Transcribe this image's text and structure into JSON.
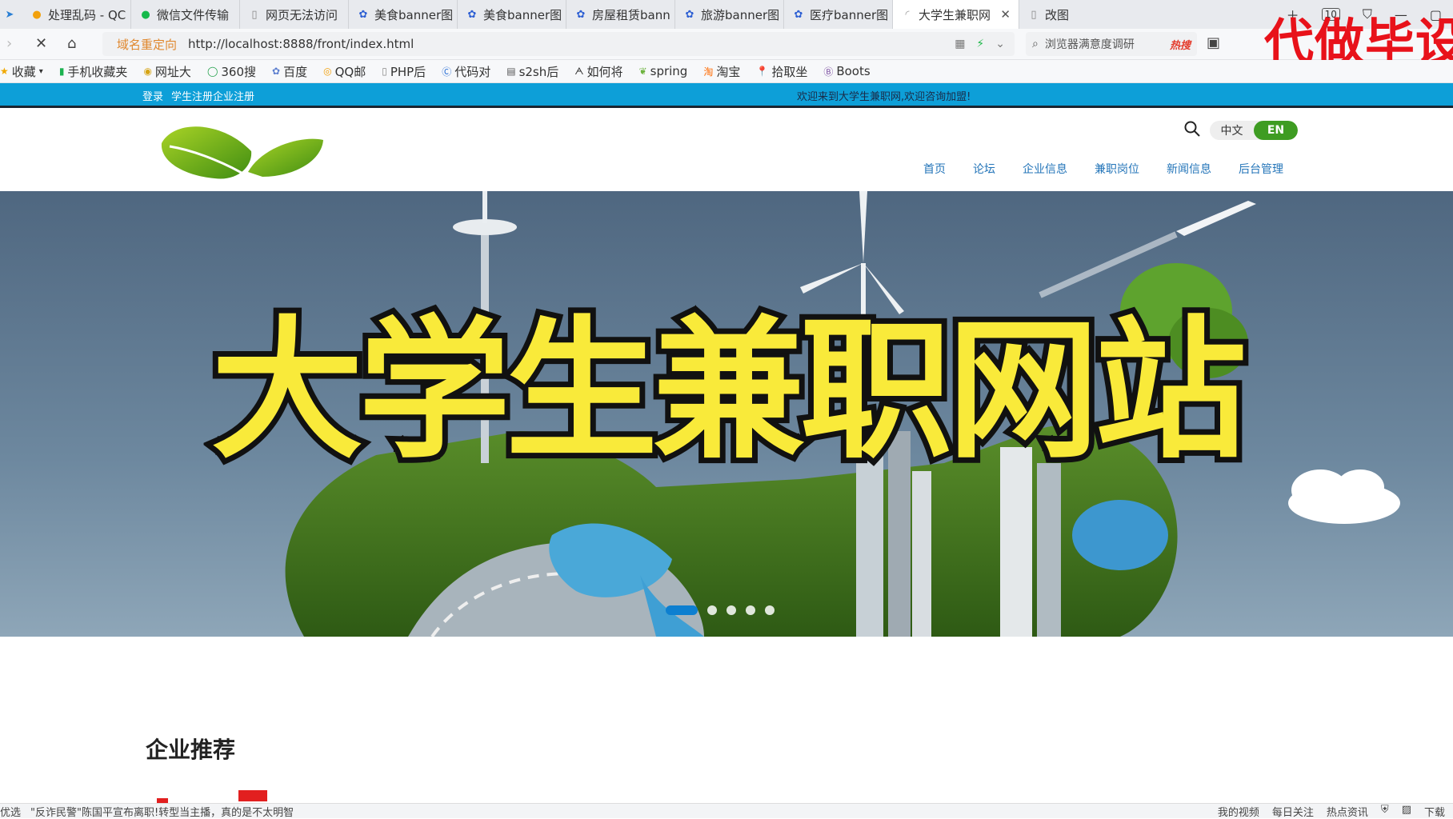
{
  "browser": {
    "tabs": [
      {
        "label": "处理乱码 - QC",
        "icon": "qq-browser-icon"
      },
      {
        "label": "微信文件传输",
        "icon": "wechat-icon"
      },
      {
        "label": "网页无法访问",
        "icon": "page-icon"
      },
      {
        "label": "美食banner图",
        "icon": "baidu-paw-icon"
      },
      {
        "label": "美食banner图",
        "icon": "baidu-paw-icon"
      },
      {
        "label": "房屋租赁bann",
        "icon": "baidu-paw-icon"
      },
      {
        "label": "旅游banner图",
        "icon": "baidu-paw-icon"
      },
      {
        "label": "医疗banner图",
        "icon": "baidu-paw-icon"
      },
      {
        "label": "大学生兼职网",
        "icon": "loading-icon",
        "active": true
      },
      {
        "label": "改图",
        "icon": "page-icon"
      }
    ],
    "tab_count": "10",
    "address": {
      "redirect_label": "域名重定向",
      "url": "http://localhost:8888/front/index.html"
    },
    "search": {
      "placeholder": "浏览器满意度调研",
      "hot_label": "热搜"
    },
    "overlay_text": "代做毕设",
    "bookmarks": [
      "收藏",
      "手机收藏夹",
      "网址大",
      "360搜",
      "百度",
      "QQ邮",
      "PHP后",
      "代码对",
      "s2sh后",
      "如何将",
      "spring",
      "淘宝",
      "拾取坐",
      "Boots"
    ]
  },
  "site": {
    "topbar": {
      "login": "登录",
      "student_register": "学生注册",
      "company_register": "企业注册",
      "welcome": "欢迎来到大学生兼职网,欢迎咨询加盟!"
    },
    "lang": {
      "zh": "中文",
      "en": "EN",
      "active": "EN"
    },
    "menu": [
      "首页",
      "论坛",
      "企业信息",
      "兼职岗位",
      "新闻信息",
      "后台管理"
    ],
    "hero": {
      "title": "大学生兼职网站",
      "slides": 5,
      "active_slide": 1
    },
    "section_title": "企业推荐"
  },
  "statusbar": {
    "left": [
      "优选",
      "\"反诈民警\"陈国平宣布离职!转型当主播，真的是不太明智"
    ],
    "right": [
      "我的视频",
      "每日关注",
      "热点资讯",
      "下载"
    ]
  },
  "colors": {
    "topbar_bg": "#0d9fd8",
    "menu_text": "#2475b9",
    "lang_active": "#3e9c22",
    "hero_title_fill": "#f9ea3a",
    "overlay_red": "#e8121a"
  }
}
